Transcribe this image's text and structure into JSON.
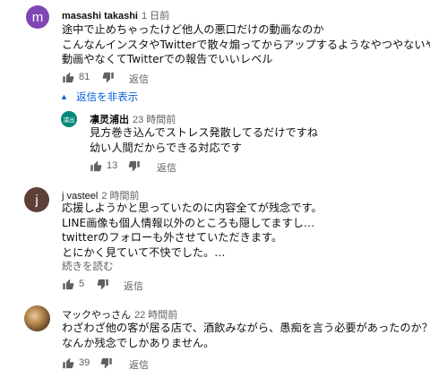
{
  "comments": [
    {
      "author": "masashi takashi",
      "time": "1 日前",
      "avatar_letter": "m",
      "avatar_color": "#8046b5",
      "lines": [
        "途中で止めちゃったけど他人の悪口だけの動画なのか",
        "こんなんインスタやTwitterで散々煽ってからアップするようなやつやないやろ",
        "動画やなくてTwitterでの報告でいいレベル"
      ],
      "likes": "81",
      "reply_label": "返信",
      "hide_replies_label": "返信を非表示",
      "replies": [
        {
          "author": "凛灵浦出",
          "time": "23 時間前",
          "avatar_text": "浦出",
          "avatar_color": "#00897b",
          "lines": [
            "見方巻き込んでストレス発散してるだけですね",
            "幼い人間だからできる対応です"
          ],
          "likes": "13",
          "reply_label": "返信"
        }
      ]
    },
    {
      "author": "j vasteel",
      "time": "2 時間前",
      "avatar_letter": "j",
      "avatar_color": "#5d4037",
      "lines": [
        "応援しようかと思っていたのに内容全てが残念です。",
        "LINE画像も個人情報以外のところも隠してますし…",
        "twitterのフォローも外させていただきます。",
        "とにかく見ていて不快でした。…"
      ],
      "read_more_label": "続きを読む",
      "likes": "5",
      "reply_label": "返信"
    },
    {
      "author": "マックやっさん",
      "time": "22 時間前",
      "avatar_color": "#8a6a3a",
      "lines": [
        "わざわざ他の客が居る店で、酒飲みながら、愚痴を言う必要があったのか？",
        "なんか残念でしかありません。"
      ],
      "likes": "39",
      "reply_label": "返信"
    }
  ]
}
